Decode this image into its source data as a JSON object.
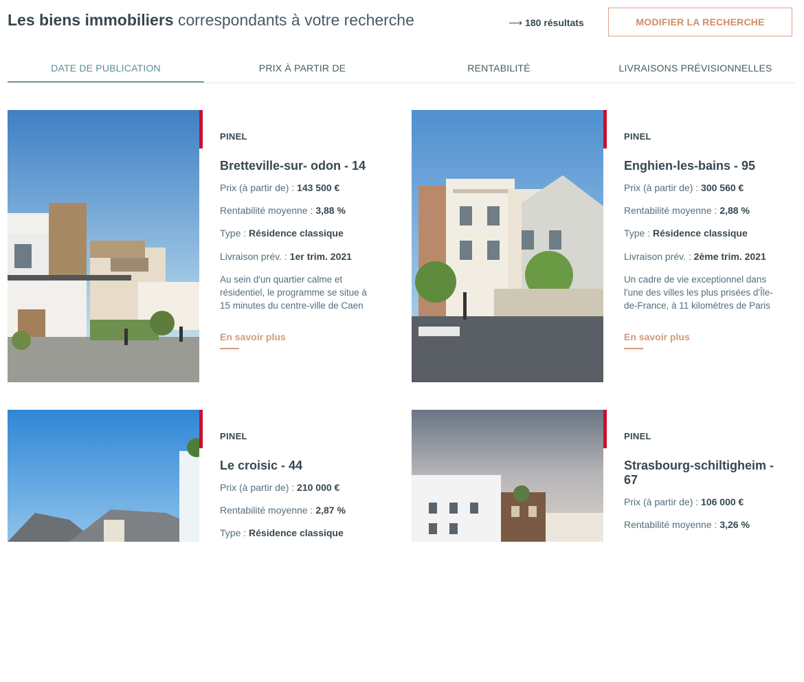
{
  "header": {
    "title_bold": "Les biens immobiliers",
    "title_rest": "correspondants à votre recherche",
    "results_arrow": "⟶",
    "results": "180 résultats",
    "modify_button": "MODIFIER LA RECHERCHE"
  },
  "tabs": [
    {
      "label": "DATE DE PUBLICATION",
      "active": true
    },
    {
      "label": "PRIX À PARTIR DE"
    },
    {
      "label": "RENTABILITÉ"
    },
    {
      "label": "LIVRAISONS PRÉVISIONNELLES"
    }
  ],
  "labels": {
    "price": "Prix (à partir de) : ",
    "yield": "Rentabilité moyenne : ",
    "type": "Type : ",
    "delivery": "Livraison prév. : ",
    "more": "En savoir plus"
  },
  "cards": [
    {
      "category": "PINEL",
      "city": "Bretteville-sur- odon - 14",
      "price": "143 500 €",
      "yield": "3,88 %",
      "type": "Résidence classique",
      "delivery": "1er trim. 2021",
      "description": "Au sein d'un quartier calme et résidentiel, le programme se situe à 15 minutes du centre-ville de Caen"
    },
    {
      "category": "PINEL",
      "city": "Enghien-les-bains - 95",
      "price": "300 560 €",
      "yield": "2,88 %",
      "type": "Résidence classique",
      "delivery": "2ème trim. 2021",
      "description": "Un cadre de vie exceptionnel dans l'une des villes les plus prisées d'Île-de-France, à 11 kilomètres de Paris"
    },
    {
      "category": "PINEL",
      "city": "Le croisic - 44",
      "price": "210 000 €",
      "yield": "2,87 %",
      "type": "Résidence classique"
    },
    {
      "category": "PINEL",
      "city": "Strasbourg-schiltigheim - 67",
      "price": "106 000 €",
      "yield": "3,26 %"
    }
  ]
}
